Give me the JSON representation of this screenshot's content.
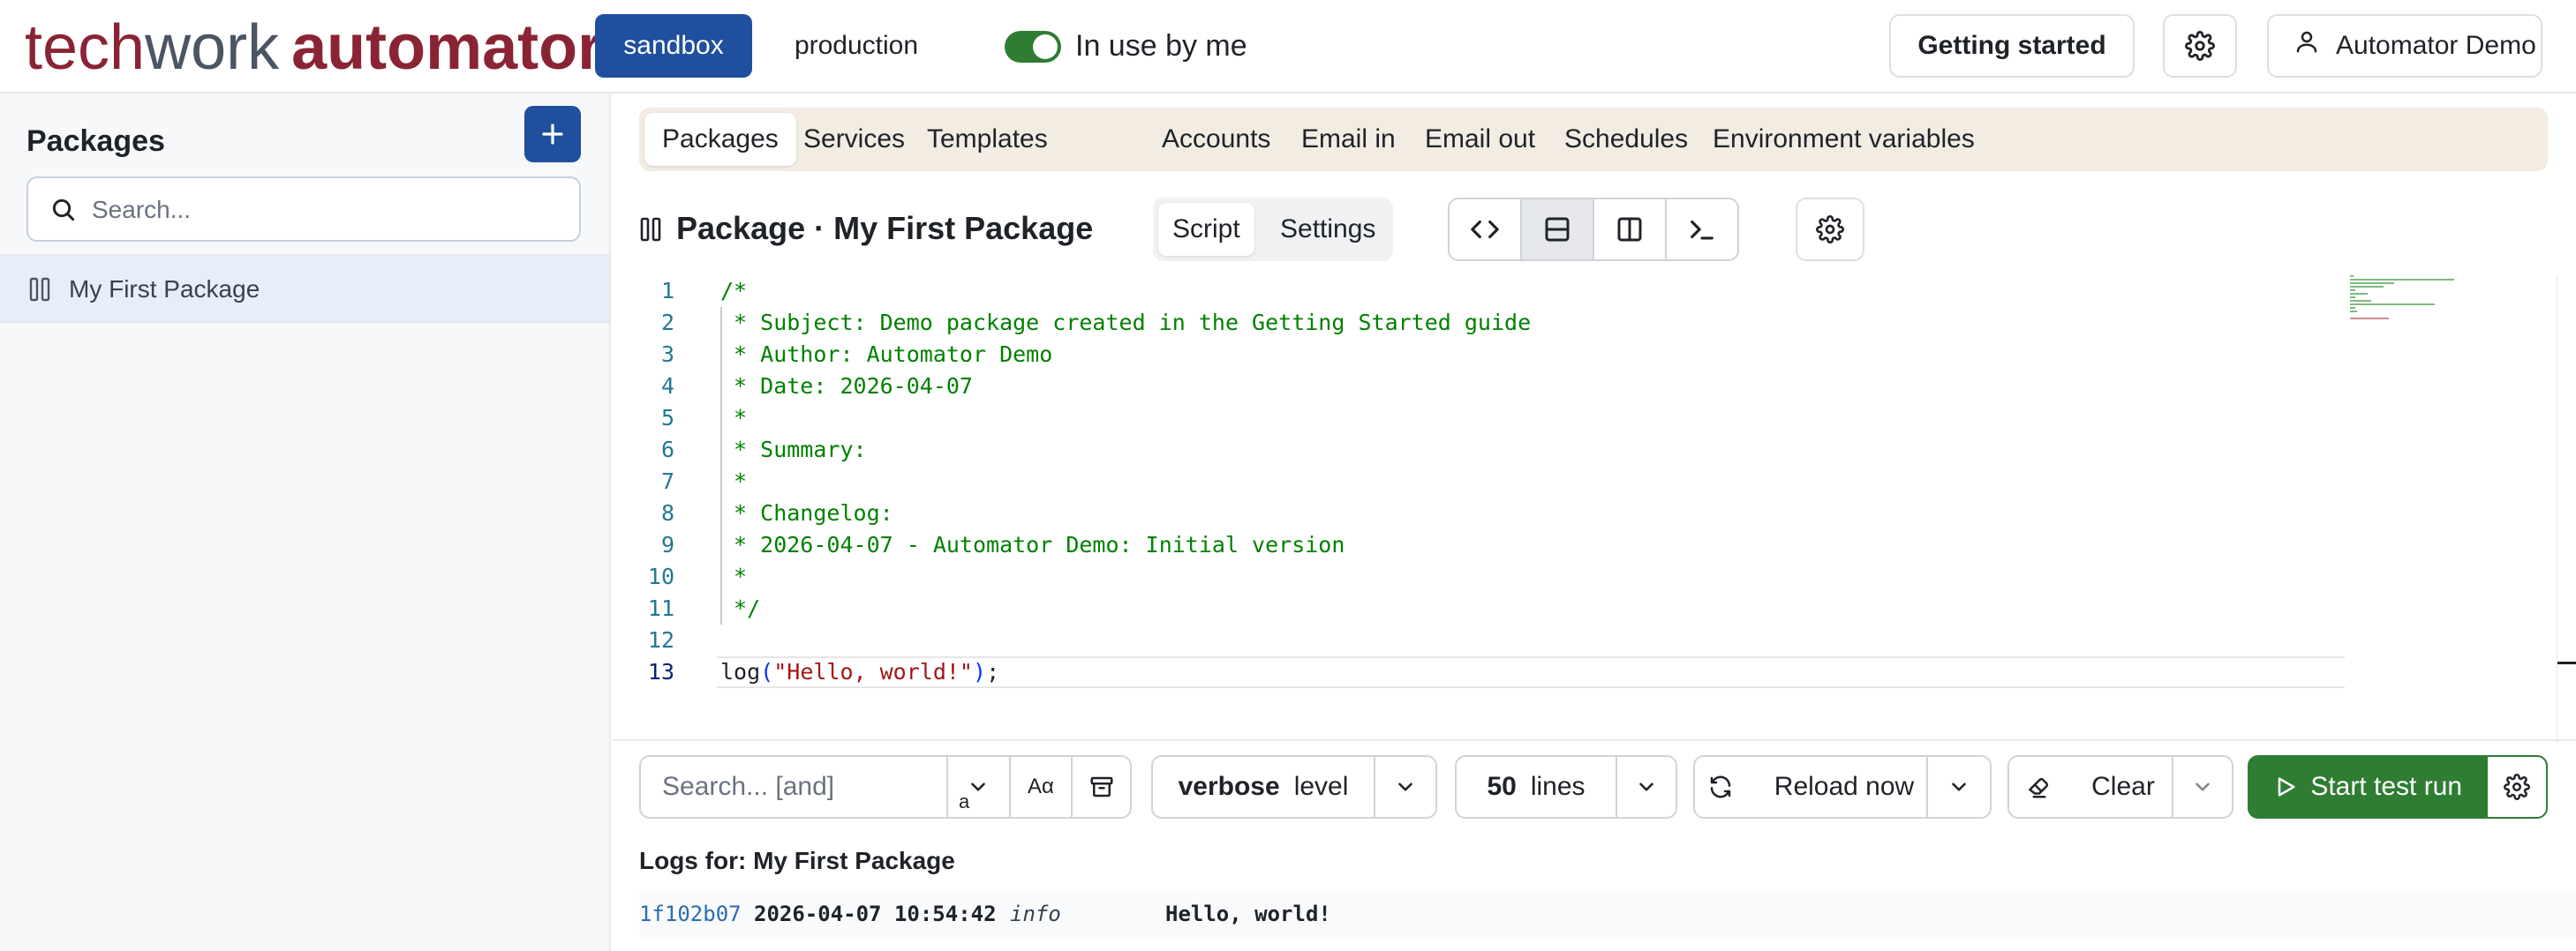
{
  "app": {
    "logo": {
      "part1": "tech",
      "part2": "work",
      "part3": "automator",
      "dot": "."
    }
  },
  "header": {
    "env_sandbox": "sandbox",
    "env_production": "production",
    "in_use_label": "In use by me",
    "getting_started": "Getting started",
    "user_name": "Automator Demo"
  },
  "sidebar": {
    "title": "Packages",
    "search_placeholder": "Search...",
    "items": [
      {
        "label": "My First Package"
      }
    ]
  },
  "subnav": {
    "tabs": [
      "Packages",
      "Services",
      "Templates",
      "Accounts",
      "Email in",
      "Email out",
      "Schedules",
      "Environment variables"
    ],
    "active": "Packages"
  },
  "package": {
    "title": "Package · My First Package",
    "view_script": "Script",
    "view_settings": "Settings"
  },
  "editor": {
    "lines": [
      {
        "n": "1",
        "text": "/*",
        "kind": "comment"
      },
      {
        "n": "2",
        "text": " * Subject: Demo package created in the Getting Started guide",
        "kind": "comment"
      },
      {
        "n": "3",
        "text": " * Author: Automator Demo",
        "kind": "comment"
      },
      {
        "n": "4",
        "text": " * Date: 2026-04-07",
        "kind": "comment"
      },
      {
        "n": "5",
        "text": " *",
        "kind": "comment"
      },
      {
        "n": "6",
        "text": " * Summary:",
        "kind": "comment"
      },
      {
        "n": "7",
        "text": " *",
        "kind": "comment"
      },
      {
        "n": "8",
        "text": " * Changelog:",
        "kind": "comment"
      },
      {
        "n": "9",
        "text": " * 2026-04-07 - Automator Demo: Initial version",
        "kind": "comment"
      },
      {
        "n": "10",
        "text": " *",
        "kind": "comment"
      },
      {
        "n": "11",
        "text": " */",
        "kind": "comment"
      },
      {
        "n": "12",
        "text": "",
        "kind": "blank"
      }
    ],
    "last_line": {
      "n": "13",
      "fn": "log",
      "open": "(",
      "str": "\"Hello, world!\"",
      "close": ")",
      "end": ";"
    }
  },
  "logs_toolbar": {
    "search_placeholder": "Search... [and]",
    "small_a": "a",
    "case_label": "Aα",
    "verbose_value": "verbose",
    "verbose_label": "level",
    "lines_value": "50",
    "lines_label": "lines",
    "reload_label": "Reload now",
    "clear_label": "Clear",
    "start_label": "Start test run"
  },
  "logs": {
    "title": "Logs for: My First Package",
    "entries": [
      {
        "id": "1f102b07",
        "timestamp": "2026-04-07 10:54:42",
        "level": "info",
        "message": "Hello, world!"
      }
    ]
  },
  "colors": {
    "brand_primary": "#1f4f9d",
    "logo_red": "#8a2434",
    "success_green": "#2e7d32",
    "subnav_bg": "#f2ece3"
  },
  "icons": [
    "plus-icon",
    "search-icon",
    "package-icon",
    "gear-icon",
    "user-icon",
    "code-icon",
    "split-horizontal-icon",
    "split-vertical-icon",
    "terminal-icon",
    "chevron-down-icon",
    "archive-icon",
    "refresh-icon",
    "eraser-icon",
    "play-icon"
  ]
}
